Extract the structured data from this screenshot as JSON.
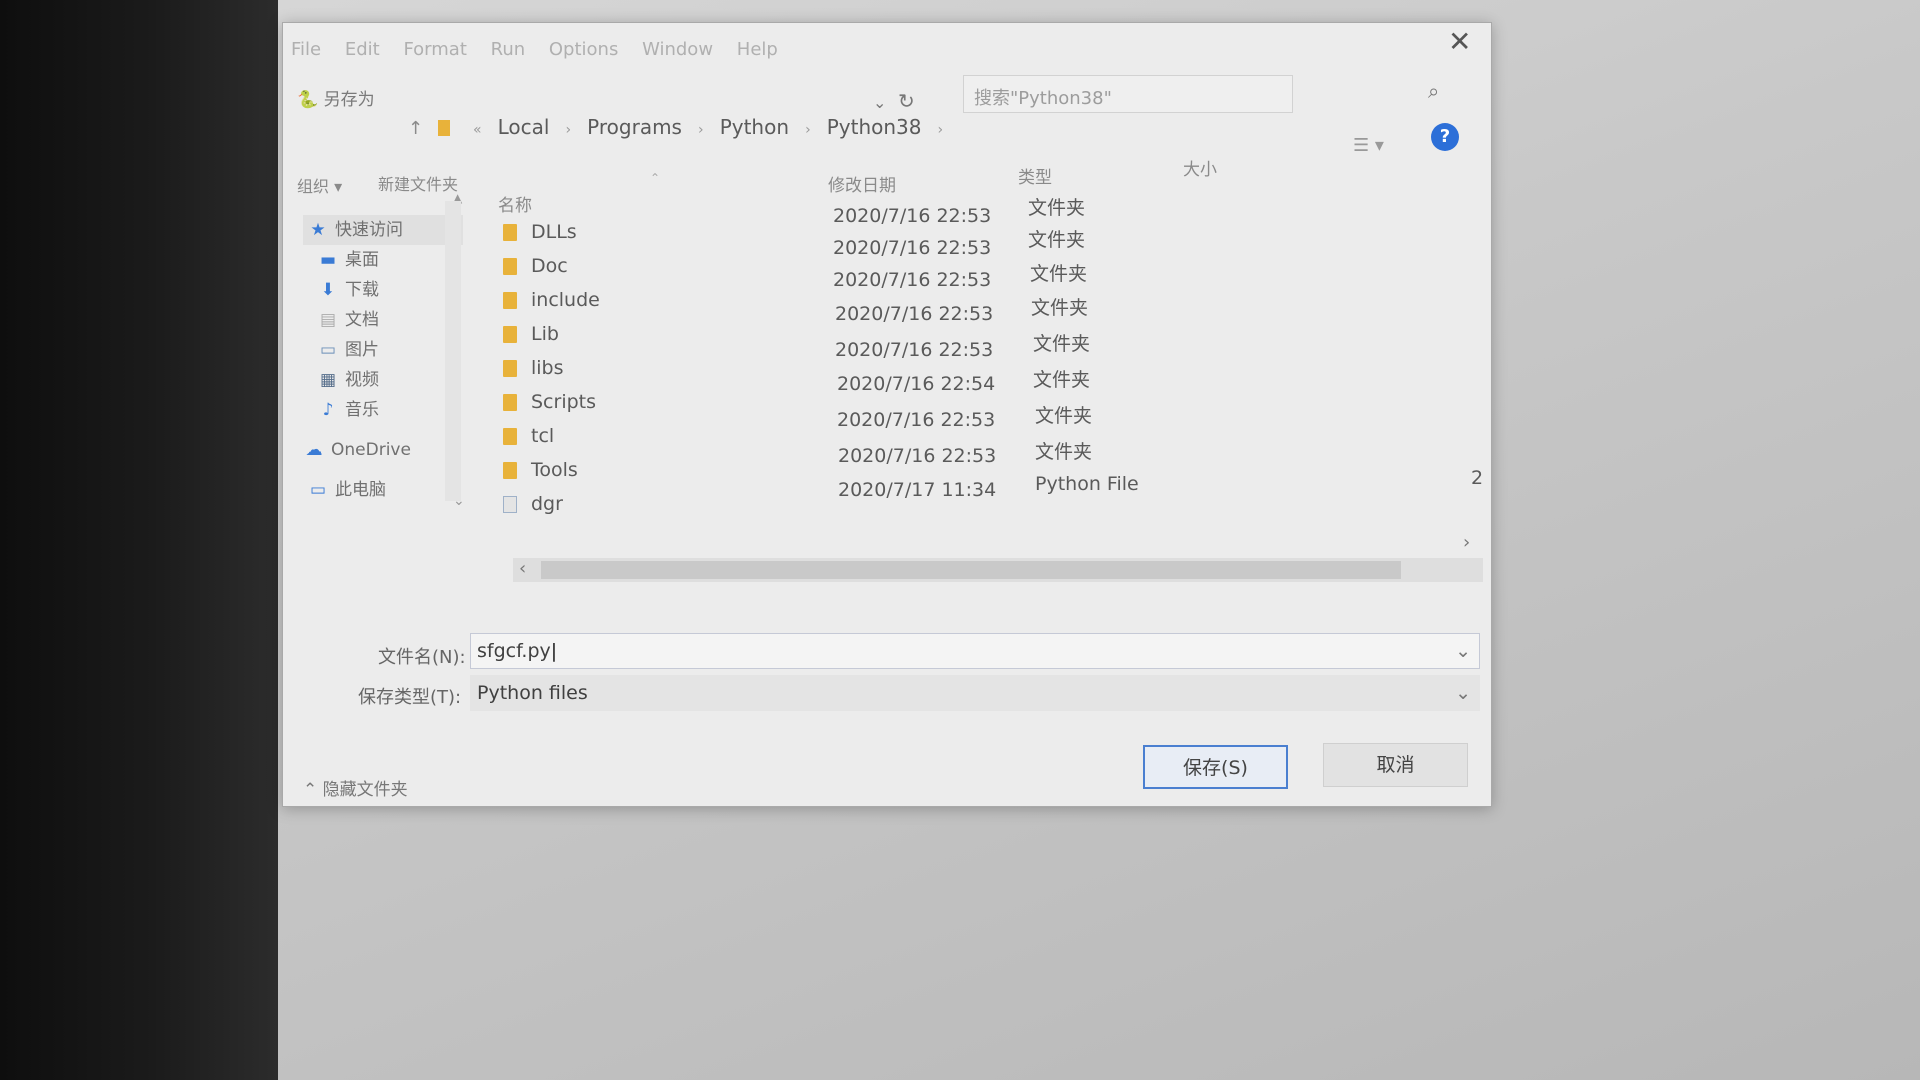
{
  "menubar": [
    "File",
    "Edit",
    "Format",
    "Run",
    "Options",
    "Window",
    "Help"
  ],
  "dialog": {
    "title": "另存为",
    "breadcrumb": [
      "Local",
      "Programs",
      "Python",
      "Python38"
    ],
    "search_placeholder": "搜索\"Python38\"",
    "toolbar": {
      "organize": "组织 ▾",
      "new_folder": "新建文件夹"
    },
    "sidebar": {
      "quick_access": "快速访问",
      "items": [
        "桌面",
        "下载",
        "文档",
        "图片",
        "视频",
        "音乐"
      ],
      "onedrive": "OneDrive",
      "this_pc": "此电脑"
    },
    "columns": {
      "name": "名称",
      "date": "修改日期",
      "type": "类型",
      "size": "大小"
    },
    "files": [
      {
        "name": "DLLs",
        "date": "2020/7/16 22:53",
        "type": "文件夹",
        "size": "",
        "kind": "folder"
      },
      {
        "name": "Doc",
        "date": "2020/7/16 22:53",
        "type": "文件夹",
        "size": "",
        "kind": "folder"
      },
      {
        "name": "include",
        "date": "2020/7/16 22:53",
        "type": "文件夹",
        "size": "",
        "kind": "folder"
      },
      {
        "name": "Lib",
        "date": "2020/7/16 22:53",
        "type": "文件夹",
        "size": "",
        "kind": "folder"
      },
      {
        "name": "libs",
        "date": "2020/7/16 22:53",
        "type": "文件夹",
        "size": "",
        "kind": "folder"
      },
      {
        "name": "Scripts",
        "date": "2020/7/16 22:54",
        "type": "文件夹",
        "size": "",
        "kind": "folder"
      },
      {
        "name": "tcl",
        "date": "2020/7/16 22:53",
        "type": "文件夹",
        "size": "",
        "kind": "folder"
      },
      {
        "name": "Tools",
        "date": "2020/7/16 22:53",
        "type": "文件夹",
        "size": "",
        "kind": "folder"
      },
      {
        "name": "dgr",
        "date": "2020/7/17 11:34",
        "type": "Python File",
        "size": "2",
        "kind": "file"
      }
    ],
    "filename_label": "文件名(N):",
    "filename_value": "sfgcf.py",
    "filetype_label": "保存类型(T):",
    "filetype_value": "Python files",
    "hide_folders": "隐藏文件夹",
    "save_button": "保存(S)",
    "cancel_button": "取消",
    "colors": {
      "folder": "#e8b23a",
      "help": "#2c6fd8",
      "primary_border": "#4a7fd0"
    }
  }
}
